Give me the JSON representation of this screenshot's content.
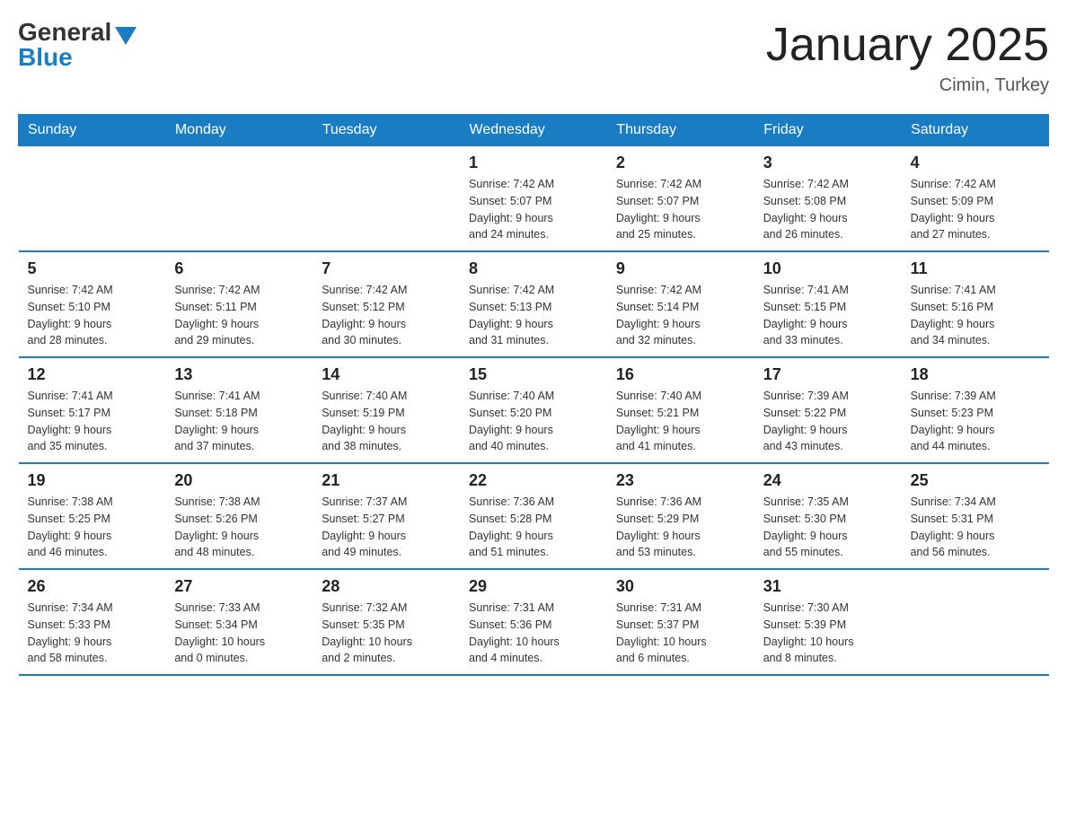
{
  "header": {
    "logo_general": "General",
    "logo_blue": "Blue",
    "month_title": "January 2025",
    "location": "Cimin, Turkey"
  },
  "weekdays": [
    "Sunday",
    "Monday",
    "Tuesday",
    "Wednesday",
    "Thursday",
    "Friday",
    "Saturday"
  ],
  "weeks": [
    [
      {
        "day": "",
        "info": ""
      },
      {
        "day": "",
        "info": ""
      },
      {
        "day": "",
        "info": ""
      },
      {
        "day": "1",
        "info": "Sunrise: 7:42 AM\nSunset: 5:07 PM\nDaylight: 9 hours\nand 24 minutes."
      },
      {
        "day": "2",
        "info": "Sunrise: 7:42 AM\nSunset: 5:07 PM\nDaylight: 9 hours\nand 25 minutes."
      },
      {
        "day": "3",
        "info": "Sunrise: 7:42 AM\nSunset: 5:08 PM\nDaylight: 9 hours\nand 26 minutes."
      },
      {
        "day": "4",
        "info": "Sunrise: 7:42 AM\nSunset: 5:09 PM\nDaylight: 9 hours\nand 27 minutes."
      }
    ],
    [
      {
        "day": "5",
        "info": "Sunrise: 7:42 AM\nSunset: 5:10 PM\nDaylight: 9 hours\nand 28 minutes."
      },
      {
        "day": "6",
        "info": "Sunrise: 7:42 AM\nSunset: 5:11 PM\nDaylight: 9 hours\nand 29 minutes."
      },
      {
        "day": "7",
        "info": "Sunrise: 7:42 AM\nSunset: 5:12 PM\nDaylight: 9 hours\nand 30 minutes."
      },
      {
        "day": "8",
        "info": "Sunrise: 7:42 AM\nSunset: 5:13 PM\nDaylight: 9 hours\nand 31 minutes."
      },
      {
        "day": "9",
        "info": "Sunrise: 7:42 AM\nSunset: 5:14 PM\nDaylight: 9 hours\nand 32 minutes."
      },
      {
        "day": "10",
        "info": "Sunrise: 7:41 AM\nSunset: 5:15 PM\nDaylight: 9 hours\nand 33 minutes."
      },
      {
        "day": "11",
        "info": "Sunrise: 7:41 AM\nSunset: 5:16 PM\nDaylight: 9 hours\nand 34 minutes."
      }
    ],
    [
      {
        "day": "12",
        "info": "Sunrise: 7:41 AM\nSunset: 5:17 PM\nDaylight: 9 hours\nand 35 minutes."
      },
      {
        "day": "13",
        "info": "Sunrise: 7:41 AM\nSunset: 5:18 PM\nDaylight: 9 hours\nand 37 minutes."
      },
      {
        "day": "14",
        "info": "Sunrise: 7:40 AM\nSunset: 5:19 PM\nDaylight: 9 hours\nand 38 minutes."
      },
      {
        "day": "15",
        "info": "Sunrise: 7:40 AM\nSunset: 5:20 PM\nDaylight: 9 hours\nand 40 minutes."
      },
      {
        "day": "16",
        "info": "Sunrise: 7:40 AM\nSunset: 5:21 PM\nDaylight: 9 hours\nand 41 minutes."
      },
      {
        "day": "17",
        "info": "Sunrise: 7:39 AM\nSunset: 5:22 PM\nDaylight: 9 hours\nand 43 minutes."
      },
      {
        "day": "18",
        "info": "Sunrise: 7:39 AM\nSunset: 5:23 PM\nDaylight: 9 hours\nand 44 minutes."
      }
    ],
    [
      {
        "day": "19",
        "info": "Sunrise: 7:38 AM\nSunset: 5:25 PM\nDaylight: 9 hours\nand 46 minutes."
      },
      {
        "day": "20",
        "info": "Sunrise: 7:38 AM\nSunset: 5:26 PM\nDaylight: 9 hours\nand 48 minutes."
      },
      {
        "day": "21",
        "info": "Sunrise: 7:37 AM\nSunset: 5:27 PM\nDaylight: 9 hours\nand 49 minutes."
      },
      {
        "day": "22",
        "info": "Sunrise: 7:36 AM\nSunset: 5:28 PM\nDaylight: 9 hours\nand 51 minutes."
      },
      {
        "day": "23",
        "info": "Sunrise: 7:36 AM\nSunset: 5:29 PM\nDaylight: 9 hours\nand 53 minutes."
      },
      {
        "day": "24",
        "info": "Sunrise: 7:35 AM\nSunset: 5:30 PM\nDaylight: 9 hours\nand 55 minutes."
      },
      {
        "day": "25",
        "info": "Sunrise: 7:34 AM\nSunset: 5:31 PM\nDaylight: 9 hours\nand 56 minutes."
      }
    ],
    [
      {
        "day": "26",
        "info": "Sunrise: 7:34 AM\nSunset: 5:33 PM\nDaylight: 9 hours\nand 58 minutes."
      },
      {
        "day": "27",
        "info": "Sunrise: 7:33 AM\nSunset: 5:34 PM\nDaylight: 10 hours\nand 0 minutes."
      },
      {
        "day": "28",
        "info": "Sunrise: 7:32 AM\nSunset: 5:35 PM\nDaylight: 10 hours\nand 2 minutes."
      },
      {
        "day": "29",
        "info": "Sunrise: 7:31 AM\nSunset: 5:36 PM\nDaylight: 10 hours\nand 4 minutes."
      },
      {
        "day": "30",
        "info": "Sunrise: 7:31 AM\nSunset: 5:37 PM\nDaylight: 10 hours\nand 6 minutes."
      },
      {
        "day": "31",
        "info": "Sunrise: 7:30 AM\nSunset: 5:39 PM\nDaylight: 10 hours\nand 8 minutes."
      },
      {
        "day": "",
        "info": ""
      }
    ]
  ]
}
